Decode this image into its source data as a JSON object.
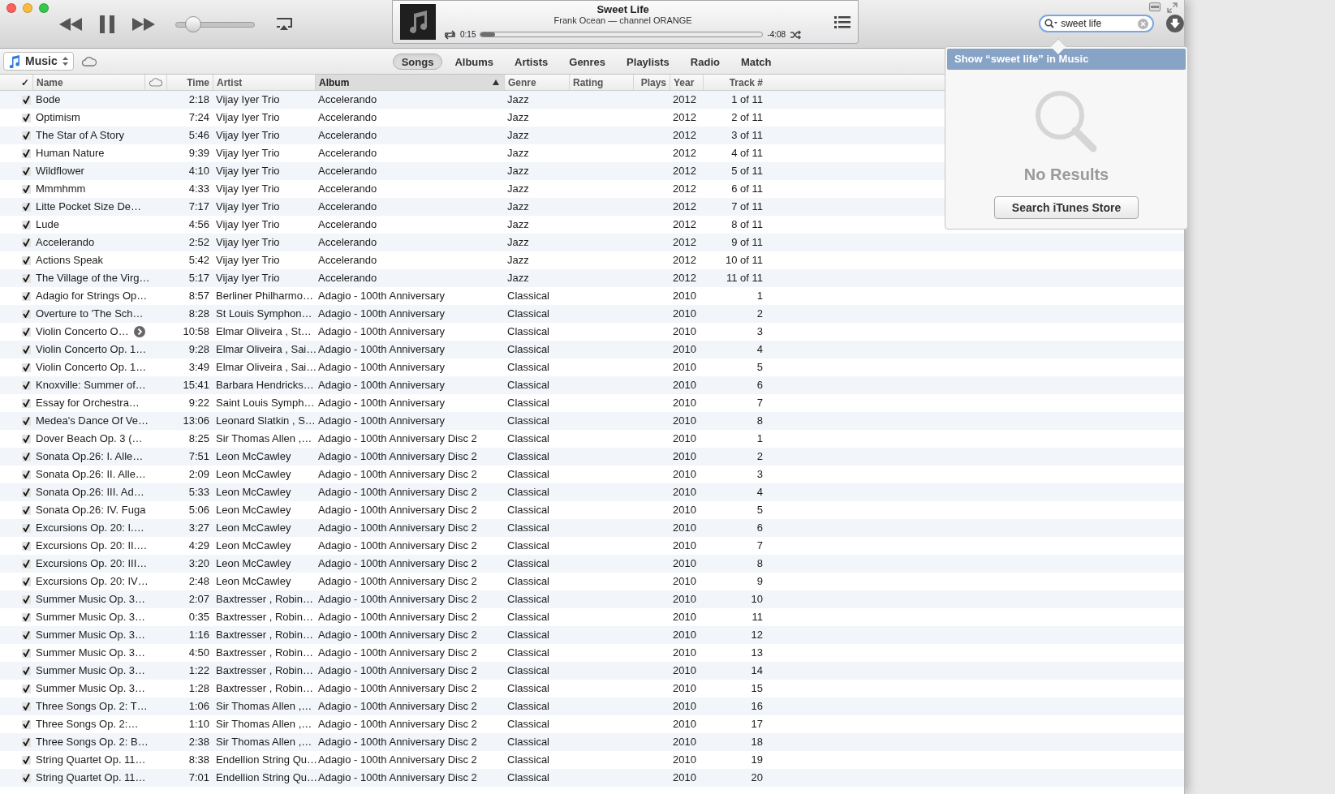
{
  "player": {
    "volume": {
      "level": 0.22
    },
    "now_playing": {
      "title": "Sweet Life",
      "subtitle": "Frank Ocean — channel ORANGE",
      "elapsed": "0:15",
      "remaining": "-4:08",
      "progress": {
        "level": 0.05
      }
    }
  },
  "search": {
    "value": "sweet life"
  },
  "library": {
    "source": "Music"
  },
  "tabs": [
    {
      "label": "Songs",
      "selected": true
    },
    {
      "label": "Albums",
      "selected": false
    },
    {
      "label": "Artists",
      "selected": false
    },
    {
      "label": "Genres",
      "selected": false
    },
    {
      "label": "Playlists",
      "selected": false
    },
    {
      "label": "Radio",
      "selected": false
    },
    {
      "label": "Match",
      "selected": false
    }
  ],
  "table": {
    "check_header": "✓",
    "columns": [
      {
        "label": "Name",
        "sorted": false
      },
      {
        "label": "Time",
        "sorted": false
      },
      {
        "label": "Artist",
        "sorted": false
      },
      {
        "label": "Album",
        "sorted": true
      },
      {
        "label": "Genre",
        "sorted": false
      },
      {
        "label": "Rating",
        "sorted": false
      },
      {
        "label": "Plays",
        "sorted": false
      },
      {
        "label": "Year",
        "sorted": false
      },
      {
        "label": "Track #",
        "sorted": false
      }
    ],
    "rows": [
      {
        "checked": true,
        "name": "Bode",
        "show_arrow": false,
        "time": "2:18",
        "artist": "Vijay Iyer Trio",
        "album": "Accelerando",
        "genre": "Jazz",
        "year": "2012",
        "track": "1 of 11"
      },
      {
        "checked": true,
        "name": "Optimism",
        "show_arrow": false,
        "time": "7:24",
        "artist": "Vijay Iyer Trio",
        "album": "Accelerando",
        "genre": "Jazz",
        "year": "2012",
        "track": "2 of 11"
      },
      {
        "checked": true,
        "name": "The Star of A Story",
        "show_arrow": false,
        "time": "5:46",
        "artist": "Vijay Iyer Trio",
        "album": "Accelerando",
        "genre": "Jazz",
        "year": "2012",
        "track": "3 of 11"
      },
      {
        "checked": true,
        "name": "Human Nature",
        "show_arrow": false,
        "time": "9:39",
        "artist": "Vijay Iyer Trio",
        "album": "Accelerando",
        "genre": "Jazz",
        "year": "2012",
        "track": "4 of 11"
      },
      {
        "checked": true,
        "name": "Wildflower",
        "show_arrow": false,
        "time": "4:10",
        "artist": "Vijay Iyer Trio",
        "album": "Accelerando",
        "genre": "Jazz",
        "year": "2012",
        "track": "5 of 11"
      },
      {
        "checked": true,
        "name": "Mmmhmm",
        "show_arrow": false,
        "time": "4:33",
        "artist": "Vijay Iyer Trio",
        "album": "Accelerando",
        "genre": "Jazz",
        "year": "2012",
        "track": "6 of 11"
      },
      {
        "checked": true,
        "name": "Litte Pocket Size De…",
        "show_arrow": false,
        "time": "7:17",
        "artist": "Vijay Iyer Trio",
        "album": "Accelerando",
        "genre": "Jazz",
        "year": "2012",
        "track": "7 of 11"
      },
      {
        "checked": true,
        "name": "Lude",
        "show_arrow": false,
        "time": "4:56",
        "artist": "Vijay Iyer Trio",
        "album": "Accelerando",
        "genre": "Jazz",
        "year": "2012",
        "track": "8 of 11"
      },
      {
        "checked": true,
        "name": "Accelerando",
        "show_arrow": false,
        "time": "2:52",
        "artist": "Vijay Iyer Trio",
        "album": "Accelerando",
        "genre": "Jazz",
        "year": "2012",
        "track": "9 of 11"
      },
      {
        "checked": true,
        "name": "Actions Speak",
        "show_arrow": false,
        "time": "5:42",
        "artist": "Vijay Iyer Trio",
        "album": "Accelerando",
        "genre": "Jazz",
        "year": "2012",
        "track": "10 of 11"
      },
      {
        "checked": true,
        "name": "The Village of the Virg…",
        "show_arrow": false,
        "time": "5:17",
        "artist": "Vijay Iyer Trio",
        "album": "Accelerando",
        "genre": "Jazz",
        "year": "2012",
        "track": "11 of 11"
      },
      {
        "checked": true,
        "name": "Adagio for Strings Op…",
        "show_arrow": false,
        "time": "8:57",
        "artist": "Berliner Philharmo…",
        "album": "Adagio - 100th Anniversary",
        "genre": "Classical",
        "year": "2010",
        "track": "1"
      },
      {
        "checked": true,
        "name": "Overture to 'The Sch…",
        "show_arrow": false,
        "time": "8:28",
        "artist": "St Louis Symphon…",
        "album": "Adagio - 100th Anniversary",
        "genre": "Classical",
        "year": "2010",
        "track": "2"
      },
      {
        "checked": true,
        "name": "Violin Concerto O…",
        "show_arrow": true,
        "time": "10:58",
        "artist": "Elmar Oliveira , St…",
        "album": "Adagio - 100th Anniversary",
        "genre": "Classical",
        "year": "2010",
        "track": "3"
      },
      {
        "checked": true,
        "name": "Violin Concerto Op. 1…",
        "show_arrow": false,
        "time": "9:28",
        "artist": "Elmar Oliveira , Sai…",
        "album": "Adagio - 100th Anniversary",
        "genre": "Classical",
        "year": "2010",
        "track": "4"
      },
      {
        "checked": true,
        "name": "Violin Concerto Op. 1…",
        "show_arrow": false,
        "time": "3:49",
        "artist": "Elmar Oliveira , Sai…",
        "album": "Adagio - 100th Anniversary",
        "genre": "Classical",
        "year": "2010",
        "track": "5"
      },
      {
        "checked": true,
        "name": "Knoxville: Summer of…",
        "show_arrow": false,
        "time": "15:41",
        "artist": "Barbara Hendricks…",
        "album": "Adagio - 100th Anniversary",
        "genre": "Classical",
        "year": "2010",
        "track": "6"
      },
      {
        "checked": true,
        "name": "Essay for Orchestra…",
        "show_arrow": false,
        "time": "9:22",
        "artist": "Saint Louis Symph…",
        "album": "Adagio - 100th Anniversary",
        "genre": "Classical",
        "year": "2010",
        "track": "7"
      },
      {
        "checked": true,
        "name": "Medea's Dance Of Ve…",
        "show_arrow": false,
        "time": "13:06",
        "artist": "Leonard Slatkin , S…",
        "album": "Adagio - 100th Anniversary",
        "genre": "Classical",
        "year": "2010",
        "track": "8"
      },
      {
        "checked": true,
        "name": "Dover Beach Op. 3 (…",
        "show_arrow": false,
        "time": "8:25",
        "artist": "Sir Thomas Allen ,…",
        "album": "Adagio - 100th Anniversary Disc 2",
        "genre": "Classical",
        "year": "2010",
        "track": "1"
      },
      {
        "checked": true,
        "name": "Sonata Op.26: I. Alle…",
        "show_arrow": false,
        "time": "7:51",
        "artist": "Leon McCawley",
        "album": "Adagio - 100th Anniversary Disc 2",
        "genre": "Classical",
        "year": "2010",
        "track": "2"
      },
      {
        "checked": true,
        "name": "Sonata Op.26: II. Alle…",
        "show_arrow": false,
        "time": "2:09",
        "artist": "Leon McCawley",
        "album": "Adagio - 100th Anniversary Disc 2",
        "genre": "Classical",
        "year": "2010",
        "track": "3"
      },
      {
        "checked": true,
        "name": "Sonata Op.26: III. Ad…",
        "show_arrow": false,
        "time": "5:33",
        "artist": "Leon McCawley",
        "album": "Adagio - 100th Anniversary Disc 2",
        "genre": "Classical",
        "year": "2010",
        "track": "4"
      },
      {
        "checked": true,
        "name": "Sonata Op.26: IV. Fuga",
        "show_arrow": false,
        "time": "5:06",
        "artist": "Leon McCawley",
        "album": "Adagio - 100th Anniversary Disc 2",
        "genre": "Classical",
        "year": "2010",
        "track": "5"
      },
      {
        "checked": true,
        "name": "Excursions Op. 20: I.…",
        "show_arrow": false,
        "time": "3:27",
        "artist": "Leon McCawley",
        "album": "Adagio - 100th Anniversary Disc 2",
        "genre": "Classical",
        "year": "2010",
        "track": "6"
      },
      {
        "checked": true,
        "name": "Excursions Op. 20: II.…",
        "show_arrow": false,
        "time": "4:29",
        "artist": "Leon McCawley",
        "album": "Adagio - 100th Anniversary Disc 2",
        "genre": "Classical",
        "year": "2010",
        "track": "7"
      },
      {
        "checked": true,
        "name": "Excursions Op. 20: III…",
        "show_arrow": false,
        "time": "3:20",
        "artist": "Leon McCawley",
        "album": "Adagio - 100th Anniversary Disc 2",
        "genre": "Classical",
        "year": "2010",
        "track": "8"
      },
      {
        "checked": true,
        "name": "Excursions Op. 20: IV…",
        "show_arrow": false,
        "time": "2:48",
        "artist": "Leon McCawley",
        "album": "Adagio - 100th Anniversary Disc 2",
        "genre": "Classical",
        "year": "2010",
        "track": "9"
      },
      {
        "checked": true,
        "name": "Summer Music Op. 3…",
        "show_arrow": false,
        "time": "2:07",
        "artist": "Baxtresser , Robin…",
        "album": "Adagio - 100th Anniversary Disc 2",
        "genre": "Classical",
        "year": "2010",
        "track": "10"
      },
      {
        "checked": true,
        "name": "Summer Music Op. 3…",
        "show_arrow": false,
        "time": "0:35",
        "artist": "Baxtresser , Robin…",
        "album": "Adagio - 100th Anniversary Disc 2",
        "genre": "Classical",
        "year": "2010",
        "track": "11"
      },
      {
        "checked": true,
        "name": "Summer Music Op. 3…",
        "show_arrow": false,
        "time": "1:16",
        "artist": "Baxtresser , Robin…",
        "album": "Adagio - 100th Anniversary Disc 2",
        "genre": "Classical",
        "year": "2010",
        "track": "12"
      },
      {
        "checked": true,
        "name": "Summer Music Op. 3…",
        "show_arrow": false,
        "time": "4:50",
        "artist": "Baxtresser , Robin…",
        "album": "Adagio - 100th Anniversary Disc 2",
        "genre": "Classical",
        "year": "2010",
        "track": "13"
      },
      {
        "checked": true,
        "name": "Summer Music Op. 3…",
        "show_arrow": false,
        "time": "1:22",
        "artist": "Baxtresser , Robin…",
        "album": "Adagio - 100th Anniversary Disc 2",
        "genre": "Classical",
        "year": "2010",
        "track": "14"
      },
      {
        "checked": true,
        "name": "Summer Music Op. 3…",
        "show_arrow": false,
        "time": "1:28",
        "artist": "Baxtresser , Robin…",
        "album": "Adagio - 100th Anniversary Disc 2",
        "genre": "Classical",
        "year": "2010",
        "track": "15"
      },
      {
        "checked": true,
        "name": "Three Songs Op. 2: T…",
        "show_arrow": false,
        "time": "1:06",
        "artist": "Sir Thomas Allen ,…",
        "album": "Adagio - 100th Anniversary Disc 2",
        "genre": "Classical",
        "year": "2010",
        "track": "16"
      },
      {
        "checked": true,
        "name": "Three Songs Op. 2:…",
        "show_arrow": false,
        "time": "1:10",
        "artist": "Sir Thomas Allen ,…",
        "album": "Adagio - 100th Anniversary Disc 2",
        "genre": "Classical",
        "year": "2010",
        "track": "17"
      },
      {
        "checked": true,
        "name": "Three Songs Op. 2: B…",
        "show_arrow": false,
        "time": "2:38",
        "artist": "Sir Thomas Allen ,…",
        "album": "Adagio - 100th Anniversary Disc 2",
        "genre": "Classical",
        "year": "2010",
        "track": "18"
      },
      {
        "checked": true,
        "name": "String Quartet Op. 11…",
        "show_arrow": false,
        "time": "8:38",
        "artist": "Endellion String Qu…",
        "album": "Adagio - 100th Anniversary Disc 2",
        "genre": "Classical",
        "year": "2010",
        "track": "19"
      },
      {
        "checked": true,
        "name": "String Quartet Op. 11…",
        "show_arrow": false,
        "time": "7:01",
        "artist": "Endellion String Qu…",
        "album": "Adagio - 100th Anniversary Disc 2",
        "genre": "Classical",
        "year": "2010",
        "track": "20"
      }
    ]
  },
  "search_popup": {
    "suggestion": "Show “sweet life” in Music",
    "message": "No Results",
    "button": "Search iTunes Store"
  }
}
